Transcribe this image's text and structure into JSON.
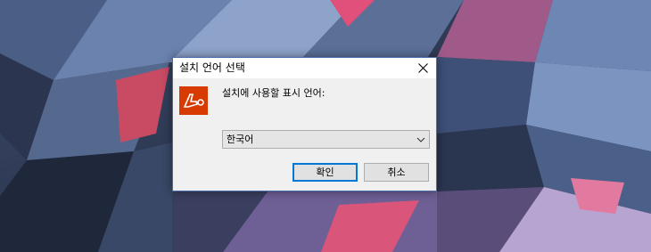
{
  "dialog": {
    "title": "설치 언어 선택",
    "prompt": "설치에 사용할 표시 언어:",
    "language": {
      "selected": "한국어"
    },
    "buttons": {
      "ok": "확인",
      "cancel": "취소"
    }
  },
  "icons": {
    "app": "installer-app-icon",
    "close": "close-icon",
    "dropdown": "chevron-down-icon"
  },
  "colors": {
    "icon_bg": "#d83b01",
    "focus_border": "#0078d7",
    "window_border": "#4a6ea9"
  }
}
